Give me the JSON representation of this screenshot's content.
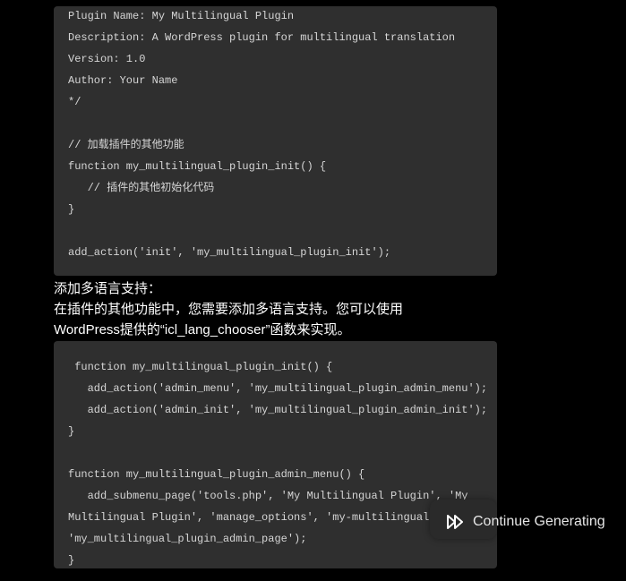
{
  "code_block_1": {
    "lines": [
      "Plugin Name: My Multilingual Plugin",
      "Description: A WordPress plugin for multilingual translation",
      "Version: 1.0",
      "Author: Your Name",
      "*/",
      "",
      "// 加载插件的其他功能",
      "function my_multilingual_plugin_init() {",
      "   // 插件的其他初始化代码",
      "}",
      "",
      "add_action('init', 'my_multilingual_plugin_init');"
    ]
  },
  "prose": {
    "heading": "添加多语言支持：",
    "line1": "在插件的其他功能中，您需要添加多语言支持。您可以使用",
    "line2": "WordPress提供的“icl_lang_chooser”函数来实现。"
  },
  "code_block_2": {
    "lines": [
      " function my_multilingual_plugin_init() {",
      "   add_action('admin_menu', 'my_multilingual_plugin_admin_menu');",
      "   add_action('admin_init', 'my_multilingual_plugin_admin_init');",
      "}",
      "",
      "function my_multilingual_plugin_admin_menu() {",
      "   add_submenu_page('tools.php', 'My Multilingual Plugin', 'My",
      "Multilingual Plugin', 'manage_options', 'my-multilingual-plugin',",
      "'my_multilingual_plugin_admin_page');",
      "}"
    ]
  },
  "continue_button": {
    "label": "Continue Generating",
    "icon": "fast-forward-icon"
  }
}
